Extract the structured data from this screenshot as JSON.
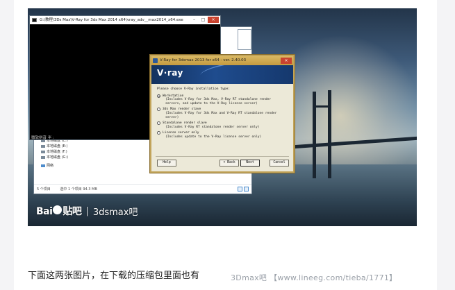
{
  "console": {
    "title": "G:\\教程\\3Ds Max\\V-Ray for 3ds Max 2014 x64\\vray_adv__max2014_x64.exe",
    "ime_text": "微软拼音 半 :",
    "min_label": "–",
    "max_label": "□",
    "close_label": "×"
  },
  "explorer": {
    "drives": [
      "本地磁盘 (C:)",
      "本地磁盘 (E:)",
      "本地磁盘 (F:)",
      "本地磁盘 (G:)"
    ],
    "network_label": "网络",
    "status_count": "5 个项目",
    "status_selected": "选中 1 个项目 94.3 MB"
  },
  "vray": {
    "title": "V-Ray for 3dsmax 2013 for x64 - ver. 2.40.03",
    "close_label": "×",
    "logo_text": "V·ray",
    "prompt": "Please choose V-Ray installation type:",
    "options": [
      {
        "label": "Workstation",
        "desc": "(Includes V-Ray for 3ds Max, V-Ray RT standalone render servers, and update to the V-Ray license server)",
        "selected": true
      },
      {
        "label": "3ds Max render slave",
        "desc": "(Includes V-Ray for 3ds Max and V-Ray RT standalone render server)",
        "selected": false
      },
      {
        "label": "Standalone render slave",
        "desc": "(Includes V-Ray RT standalone render server only)",
        "selected": false
      },
      {
        "label": "License server only",
        "desc": "(Includes update to the V-Ray license server only)",
        "selected": false
      }
    ],
    "help_button": "Help",
    "back_button": "< Back",
    "next_button": "Next",
    "cancel_button": "Cancel"
  },
  "watermark": {
    "logo": "Bai",
    "logo_suffix": "贴吧",
    "separator": "|",
    "forum": "3dsmax吧"
  },
  "caption": "下面这两张图片，在下载的压缩包里面也有",
  "footer_watermark": "3Dmax吧 【www.lineeg.com/tieba/1771】",
  "colors": {
    "vray_title": "#c49a40",
    "vray_banner": "#1f4c8e",
    "console_bg": "#000000",
    "close_red": "#c9432f"
  }
}
